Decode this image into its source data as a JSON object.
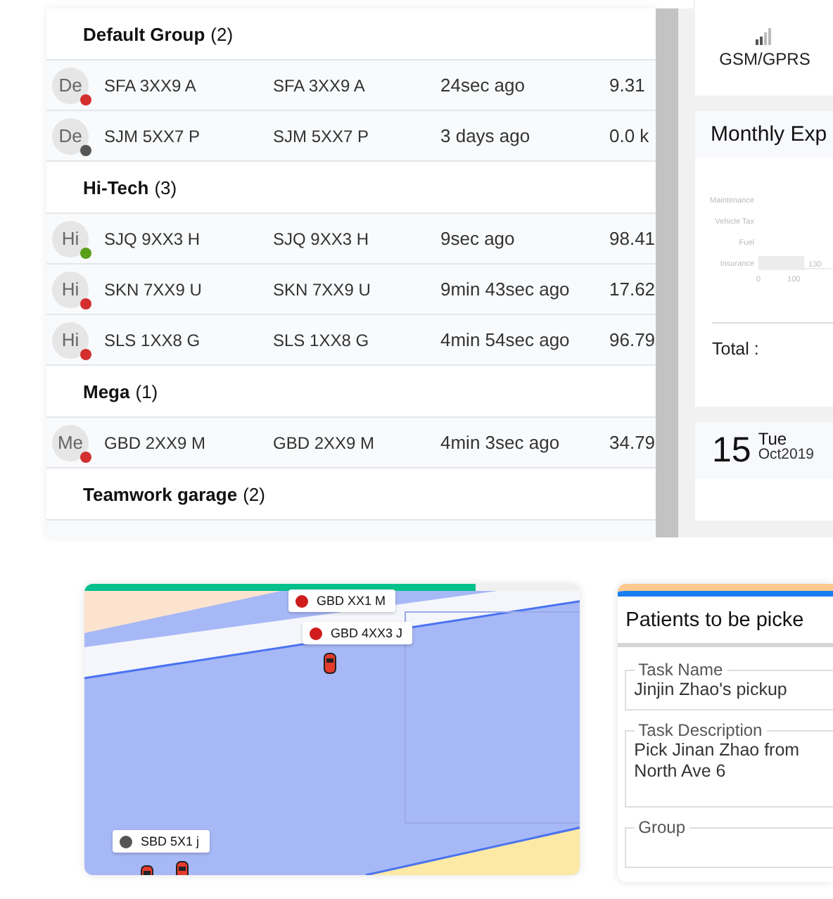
{
  "vehicle_list": {
    "groups": [
      {
        "name": "Default Group",
        "count": "(2)",
        "vehicles": [
          {
            "avatar": "De",
            "color": "#d32f2f",
            "name": "SFA 3XX9 A",
            "plate": "SFA 3XX9 A",
            "last_update": "24sec ago",
            "distance": "9.31"
          },
          {
            "avatar": "De",
            "color": "#555555",
            "name": "SJM 5XX7 P",
            "plate": "SJM 5XX7 P",
            "last_update": "3 days ago",
            "distance": "0.0 k"
          }
        ]
      },
      {
        "name": "Hi-Tech",
        "count": "(3)",
        "vehicles": [
          {
            "avatar": "Hi",
            "color": "#5a9e1a",
            "name": "SJQ 9XX3 H",
            "plate": "SJQ 9XX3 H",
            "last_update": "9sec ago",
            "distance": "98.41"
          },
          {
            "avatar": "Hi",
            "color": "#d32f2f",
            "name": "SKN 7XX9 U",
            "plate": "SKN 7XX9 U",
            "last_update": "9min 43sec ago",
            "distance": "17.62"
          },
          {
            "avatar": "Hi",
            "color": "#d32f2f",
            "name": "SLS 1XX8 G",
            "plate": "SLS 1XX8 G",
            "last_update": "4min 54sec ago",
            "distance": "96.79"
          }
        ]
      },
      {
        "name": "Mega",
        "count": "(1)",
        "vehicles": [
          {
            "avatar": "Me",
            "color": "#d32f2f",
            "name": "GBD 2XX9 M",
            "plate": "GBD 2XX9 M",
            "last_update": "4min 3sec ago",
            "distance": "34.79"
          }
        ]
      },
      {
        "name": "Teamwork garage",
        "count": "(2)"
      }
    ]
  },
  "side_panels": {
    "network": {
      "label": "GSM/GPRS"
    },
    "expenses": {
      "title": "Monthly Exp",
      "chart_data": {
        "type": "bar",
        "orientation": "horizontal",
        "categories": [
          "Maintenance",
          "Vehicle Tax",
          "Fuel",
          "Insurance"
        ],
        "values": [
          null,
          null,
          null,
          130
        ],
        "data_labels": true,
        "xlim": [
          0,
          215
        ],
        "xticks": [
          0,
          100
        ]
      },
      "total_label": "Total :"
    },
    "date": {
      "day": "15",
      "weekday": "Tue",
      "month_year": "Oct2019"
    }
  },
  "map": {
    "progress": {
      "level": 0.79
    },
    "markers": [
      {
        "label": "GBD XX1 M",
        "color": "#d01c1c"
      },
      {
        "label": "GBD 4XX3 J",
        "color": "#d01c1c"
      },
      {
        "label": "SBD 5X1 j",
        "color": "#555555"
      }
    ]
  },
  "task": {
    "title": "Patients to be picke",
    "fields": [
      {
        "label": "Task Name",
        "value": "Jinjin Zhao's pickup"
      },
      {
        "label": "Task Description",
        "value": "Pick Jinan Zhao from\nNorth Ave 6"
      },
      {
        "label": "Group"
      }
    ]
  }
}
